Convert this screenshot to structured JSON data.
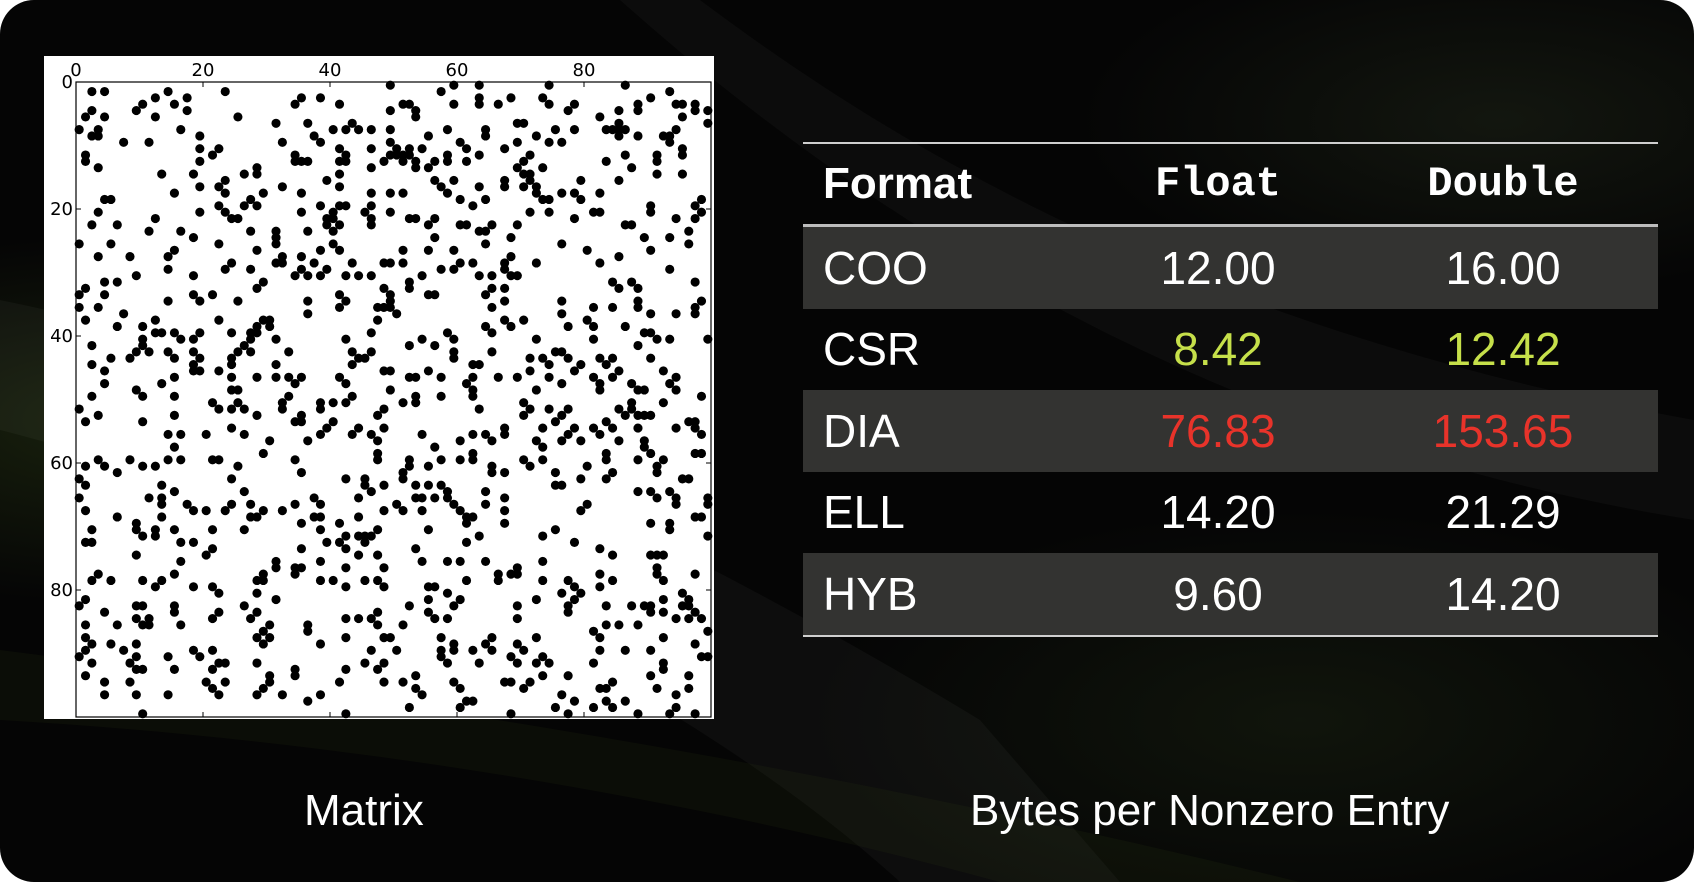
{
  "colors": {
    "background": "#050505",
    "row_shade": "#333331",
    "text": "#ffffff",
    "good": "#c6e04a",
    "bad": "#e8332a"
  },
  "matrix": {
    "x_ticks": [
      "0",
      "20",
      "40",
      "60",
      "80"
    ],
    "y_ticks": [
      "0",
      "20",
      "40",
      "60",
      "80"
    ],
    "size": 100
  },
  "table": {
    "headers": {
      "format": "Format",
      "float": "Float",
      "double": "Double"
    },
    "rows": [
      {
        "format": "COO",
        "float": "12.00",
        "double": "16.00",
        "highlight": "none"
      },
      {
        "format": "CSR",
        "float": "8.42",
        "double": "12.42",
        "highlight": "good"
      },
      {
        "format": "DIA",
        "float": "76.83",
        "double": "153.65",
        "highlight": "bad"
      },
      {
        "format": "ELL",
        "float": "14.20",
        "double": "21.29",
        "highlight": "none"
      },
      {
        "format": "HYB",
        "float": "9.60",
        "double": "14.20",
        "highlight": "none"
      }
    ]
  },
  "captions": {
    "matrix": "Matrix",
    "table": "Bytes per Nonzero Entry"
  }
}
